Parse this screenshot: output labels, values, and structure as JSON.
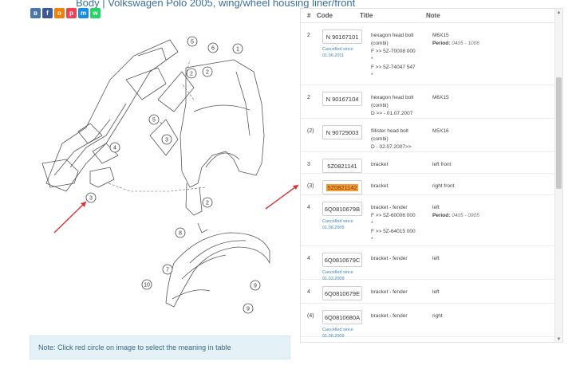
{
  "header": {
    "title_fragment": "Body | Volkswagen Polo 2005, wing/wheel housing liner/front",
    "social_icons": [
      {
        "name": "vk-icon",
        "letter": "в",
        "color": "#4a76a8"
      },
      {
        "name": "facebook-icon",
        "letter": "f",
        "color": "#3b5998"
      },
      {
        "name": "odnoklassniki-icon",
        "letter": "o",
        "color": "#ee8208"
      },
      {
        "name": "pocket-icon",
        "letter": "p",
        "color": "#ef4056"
      },
      {
        "name": "mail-icon",
        "letter": "m",
        "color": "#168de2"
      },
      {
        "name": "whatsapp-icon",
        "letter": "w",
        "color": "#25d366"
      }
    ]
  },
  "diagram": {
    "callouts": [
      "5",
      "6",
      "1",
      "2",
      "2",
      "5",
      "3",
      "4",
      "3",
      "2",
      "8",
      "7",
      "9",
      "10",
      "9"
    ]
  },
  "note": {
    "text": "Note: Click red circle on image to select the meaning in table"
  },
  "table": {
    "headers": {
      "num": "#",
      "code": "Code",
      "title": "Title",
      "note": "Note"
    },
    "rows": [
      {
        "num": "2",
        "code": "N 90167101",
        "cancelled": "Cancelled since",
        "cancel_date": "01.06.2011",
        "title_lines": [
          "hexagon head bolt",
          "(combi)",
          "F >> 5Z-70008 000",
          "*",
          "F >> 5Z-74047 547",
          "*"
        ],
        "note_lines": [
          "M6X15"
        ],
        "period_label": "Period:",
        "period_value": "0405 - 1006"
      },
      {
        "num": "2",
        "code": "N 90167104",
        "title_lines": [
          "hexagon head bolt",
          "(combi)",
          "D >> - 01.07.2007"
        ],
        "note_lines": [
          "M6X15"
        ]
      },
      {
        "num": "(2)",
        "code": "N 90729003",
        "title_lines": [
          "fillister head bolt",
          "(combi)",
          "D - 02.07.2007>>"
        ],
        "note_lines": [
          "M5X16"
        ]
      },
      {
        "num": "3",
        "code": "5Z0821141",
        "title_lines": [
          "bracket"
        ],
        "note_lines": [
          "left front"
        ]
      },
      {
        "num": "(3)",
        "code": "5Z0821142",
        "highlight": true,
        "title_lines": [
          "bracket"
        ],
        "note_lines": [
          "right front"
        ]
      },
      {
        "num": "4",
        "code": "6Q0810679B",
        "cancelled": "Cancelled since",
        "cancel_date": "01.08.2005",
        "title_lines": [
          "bracket - fender",
          "F >> 5Z-60006 000",
          "*",
          "F >> 5Z-64015 000",
          "*"
        ],
        "note_lines": [
          "left"
        ],
        "period_label": "Period:",
        "period_value": "0405 - 0905"
      },
      {
        "num": "4",
        "code": "6Q0810679C",
        "cancelled": "Cancelled since",
        "cancel_date": "01.03.2009",
        "title_lines": [
          "bracket - fender"
        ],
        "note_lines": [
          "left"
        ]
      },
      {
        "num": "4",
        "code": "6Q0810679E",
        "title_lines": [
          "bracket - fender"
        ],
        "note_lines": [
          "left"
        ]
      },
      {
        "num": "(4)",
        "code": "6Q0810680A",
        "cancelled": "Cancelled since",
        "cancel_date": "01.08.2009",
        "title_lines": [
          "bracket - fender"
        ],
        "note_lines": [
          "right"
        ]
      }
    ]
  },
  "colors": {
    "arrow": "#d9343a",
    "link": "#3b88c8",
    "highlight": "#f49c34",
    "note_bg": "#e4f1f7"
  }
}
